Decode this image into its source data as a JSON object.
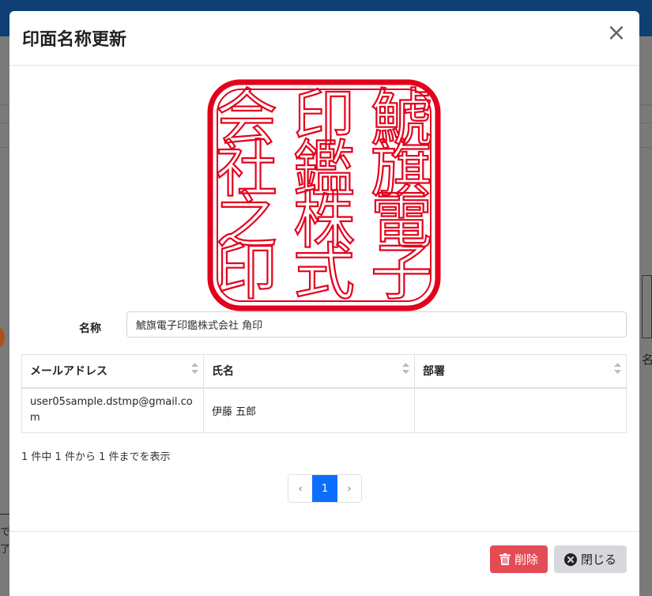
{
  "modal": {
    "title": "印面名称更新",
    "close_symbol": "×",
    "name_label": "名称",
    "name_value": "鯱旗電子印鑑株式会社 角印",
    "seal": {
      "color": "#e3001b",
      "characters": [
        "鯱",
        "旗",
        "電",
        "子",
        "印",
        "鑑",
        "株",
        "式",
        "会",
        "社",
        "之",
        "印"
      ]
    },
    "table": {
      "columns": [
        "メールアドレス",
        "氏名",
        "部署"
      ],
      "rows": [
        {
          "email": "user05sample.dstmp@gmail.com",
          "name": "伊藤 五郎",
          "department": ""
        }
      ]
    },
    "info": "1 件中 1 件から 1 件までを表示",
    "pagination": {
      "prev": "‹",
      "current": "1",
      "next": "›"
    },
    "buttons": {
      "delete": "削除",
      "close": "閉じる"
    },
    "colors": {
      "primary": "#0d6efd",
      "danger": "#e34c55",
      "secondary": "#d6d8db"
    }
  },
  "background": {
    "edge_right": "名",
    "edge_left_1": "で",
    "edge_left_2": "了"
  }
}
